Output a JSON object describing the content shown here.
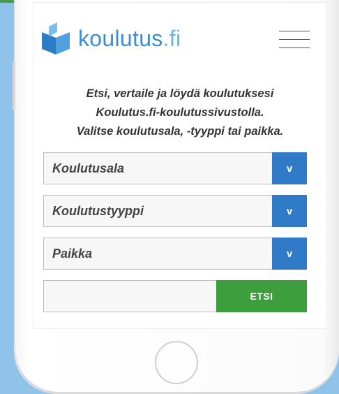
{
  "colors": {
    "background": "#8fc3ea",
    "accent": "#2f7bc8",
    "brand": "#3b8fd0",
    "search_button": "#3d9e3d",
    "top_bar": "#4a9a4a"
  },
  "header": {
    "logo_icon": "book-logo-icon",
    "logo_name": "koulutus",
    "logo_suffix": ".fi",
    "menu_icon": "hamburger-menu-icon"
  },
  "intro": {
    "line1": "Etsi, vertaile ja löydä koulutuksesi",
    "line2": "Koulutus.fi-koulutussivustolla.",
    "line3": "Valitse koulutusala, -tyyppi tai paikka."
  },
  "filters": {
    "field": {
      "selected": "Koulutusala",
      "arrow": "v"
    },
    "type": {
      "selected": "Koulutustyyppi",
      "arrow": "v"
    },
    "place": {
      "selected": "Paikka",
      "arrow": "v"
    }
  },
  "search": {
    "value": "",
    "button_label": "ETSI"
  }
}
